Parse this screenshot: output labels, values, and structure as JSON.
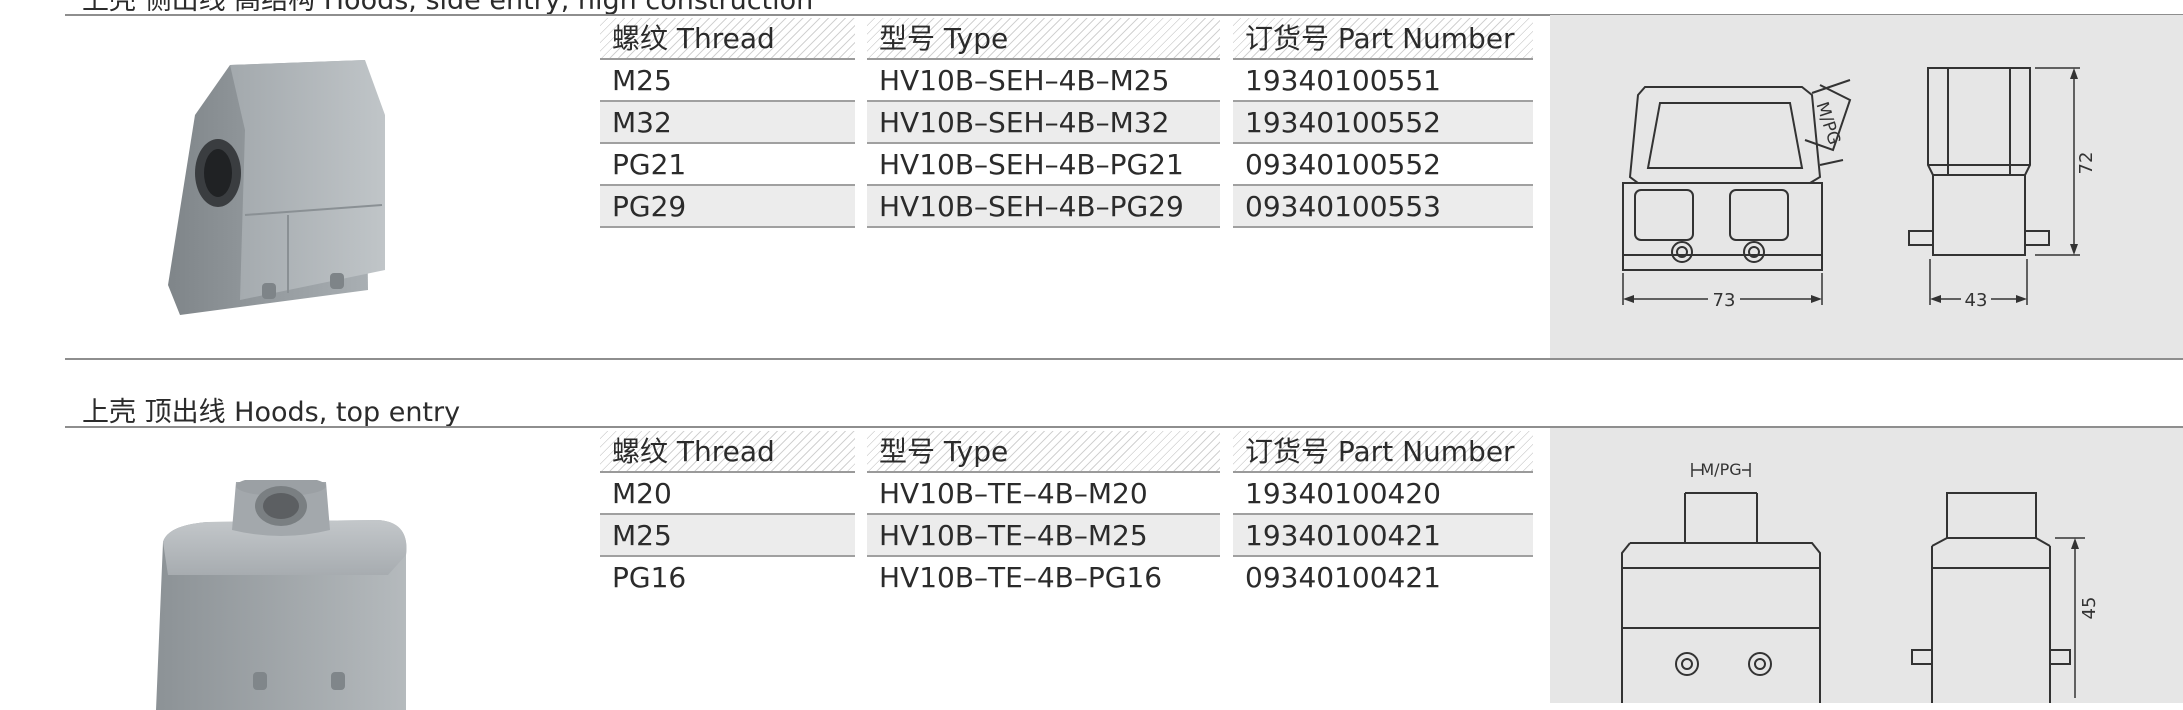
{
  "section1": {
    "title": "上壳 侧出线 高结构 Hoods, side entry, high construction",
    "headers": {
      "thread": "螺纹 Thread",
      "type": "型号 Type",
      "part": "订货号 Part Number"
    },
    "rows": [
      {
        "thread": "M25",
        "type": "HV10B–SEH–4B–M25",
        "part": "19340100551"
      },
      {
        "thread": "M32",
        "type": "HV10B–SEH–4B–M32",
        "part": "19340100552"
      },
      {
        "thread": "PG21",
        "type": "HV10B–SEH–4B–PG21",
        "part": "09340100552"
      },
      {
        "thread": "PG29",
        "type": "HV10B–SEH–4B–PG29",
        "part": "09340100553"
      }
    ],
    "drawing": {
      "thread_label": "M/PG",
      "height": "72",
      "width_front": "73",
      "width_side": "43"
    }
  },
  "section2": {
    "title": "上壳 顶出线  Hoods, top entry",
    "headers": {
      "thread": "螺纹 Thread",
      "type": "型号 Type",
      "part": "订货号 Part Number"
    },
    "rows": [
      {
        "thread": "M20",
        "type": "HV10B–TE–4B–M20",
        "part": "19340100420"
      },
      {
        "thread": "M25",
        "type": "HV10B–TE–4B–M25",
        "part": "19340100421"
      },
      {
        "thread": "PG16",
        "type": "HV10B–TE–4B–PG16",
        "part": "09340100421"
      }
    ],
    "drawing": {
      "thread_label": "M/PG",
      "height": "45"
    }
  }
}
